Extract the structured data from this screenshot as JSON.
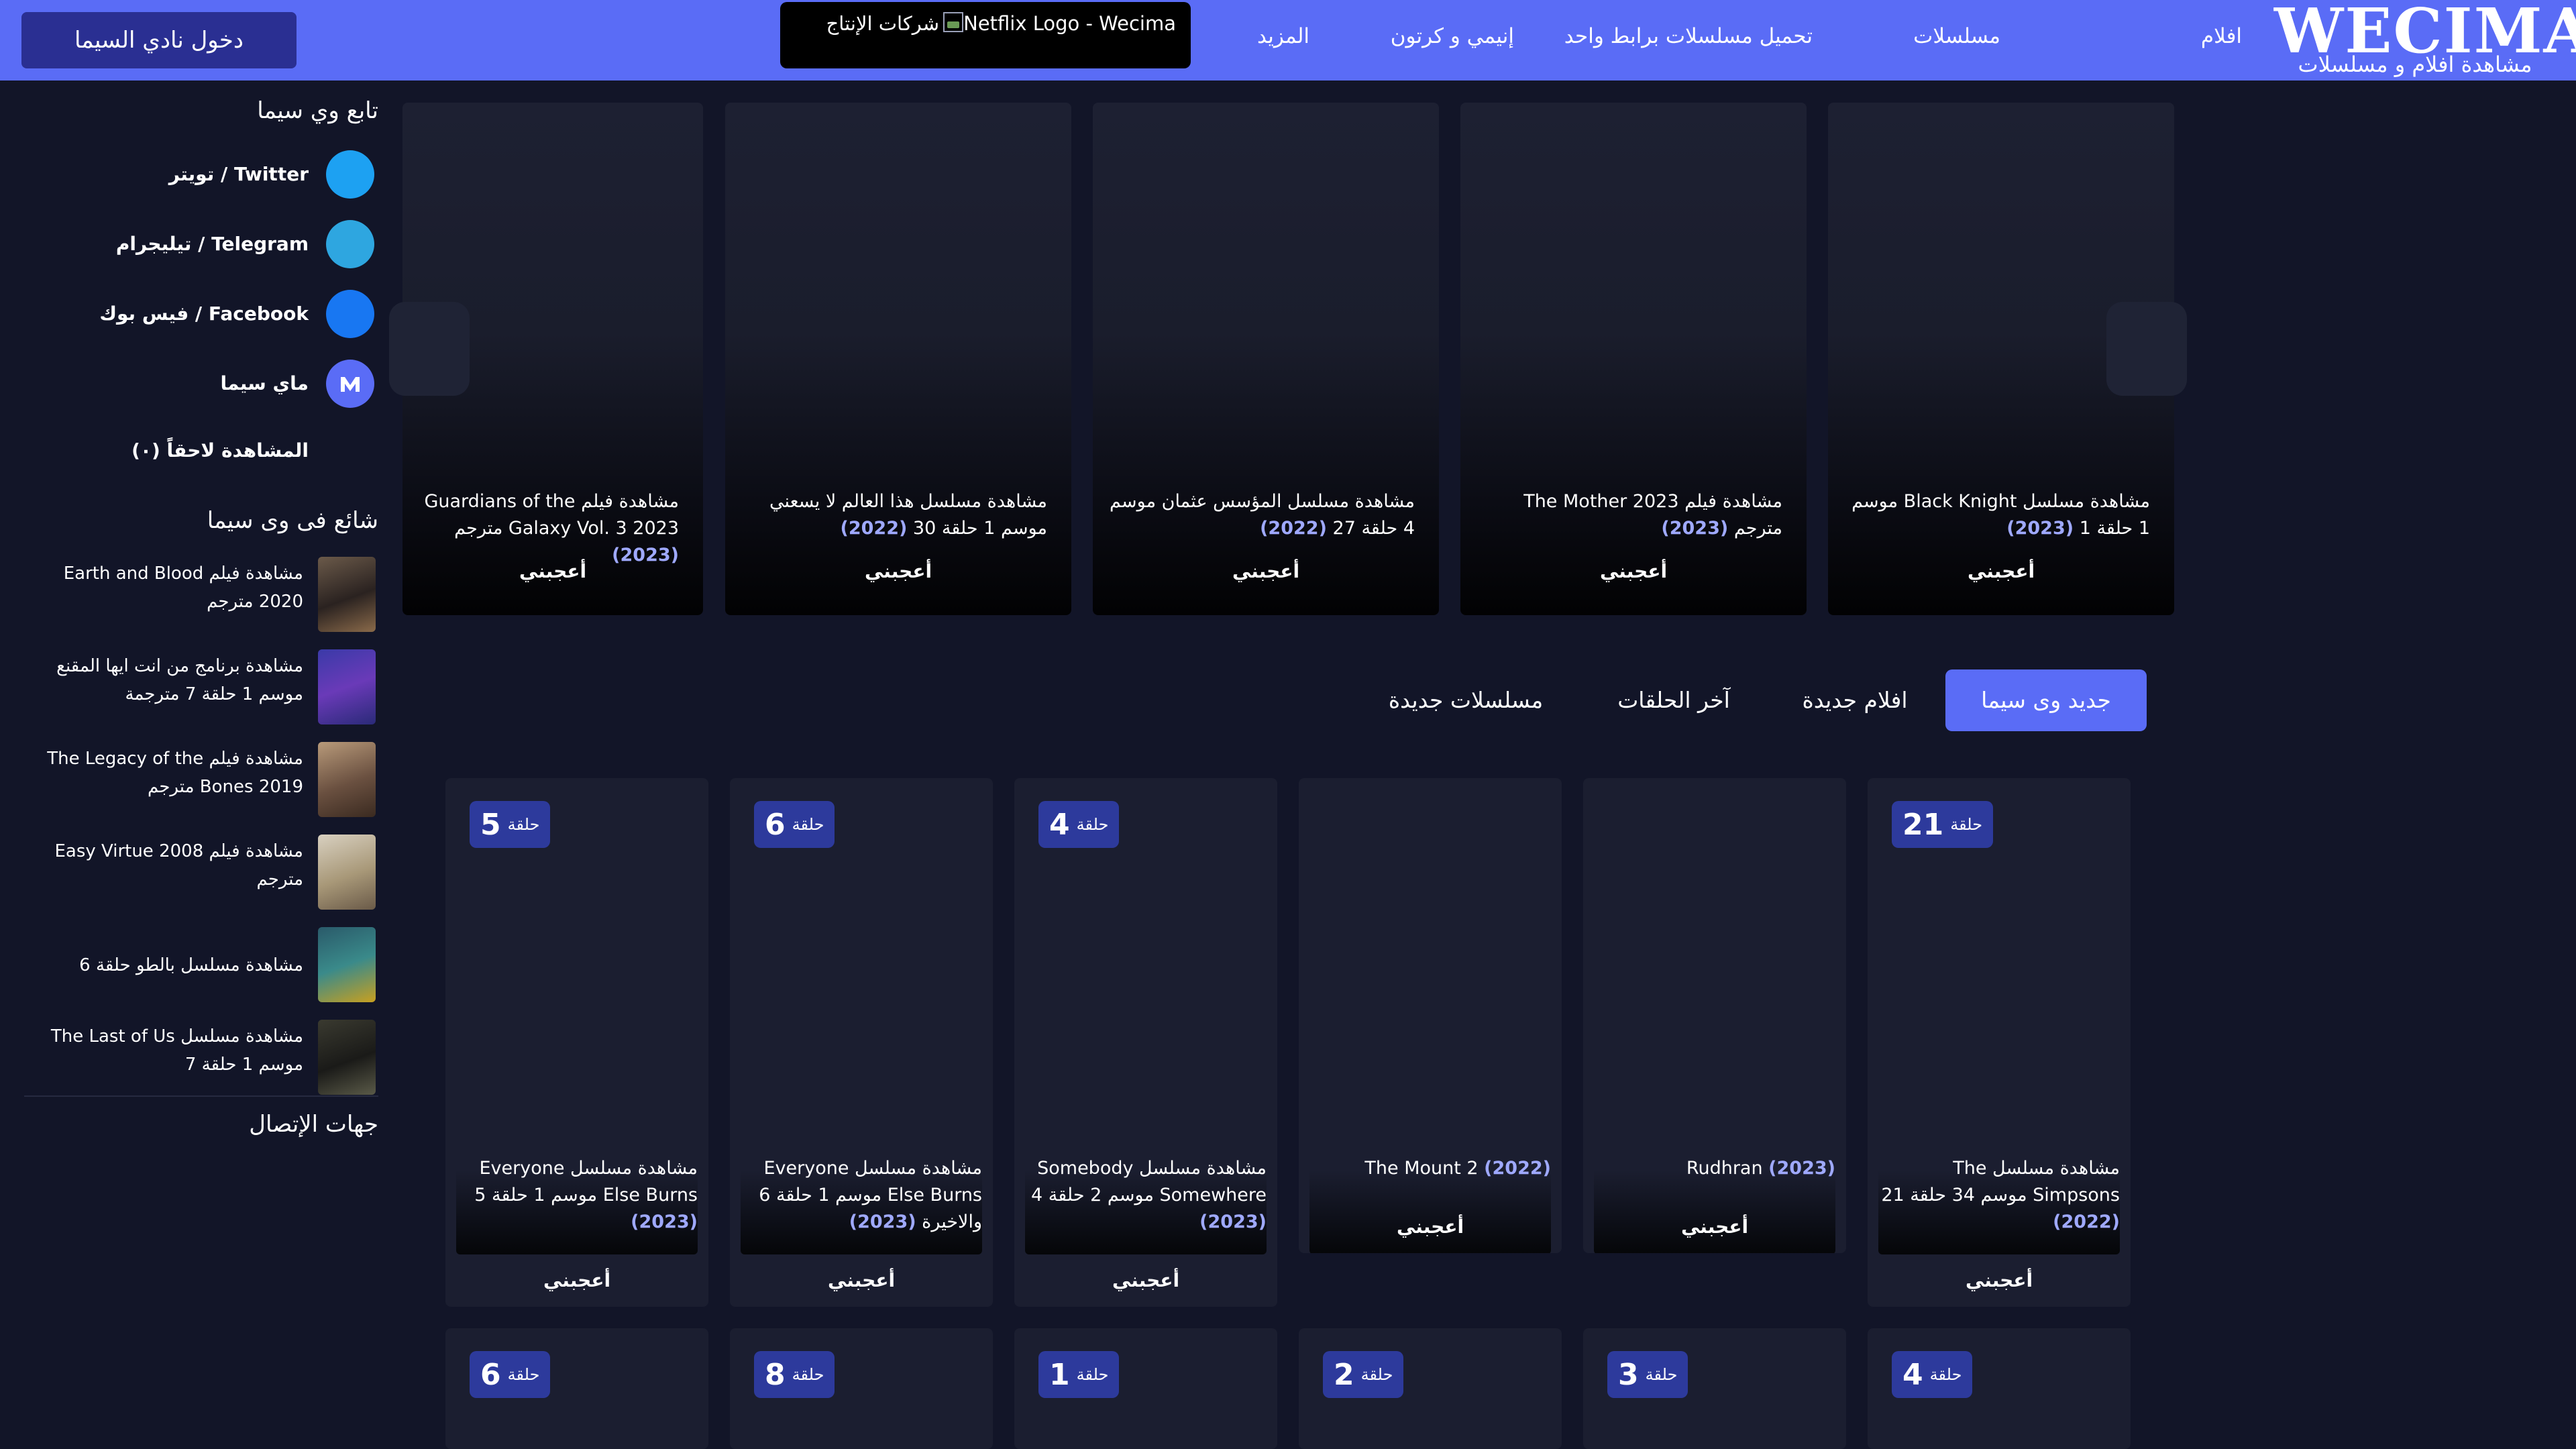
{
  "header": {
    "logo_main": "WECIMA",
    "logo_sub": "مشاهدة افلام و مسلسلات",
    "nav": [
      "افلام",
      "مسلسلات",
      "تحميل مسلسلات برابط واحد",
      "إنيمي و كرتون",
      "المزيد"
    ],
    "netflix_img_alt": "Netflix Logo - Wecima",
    "netflix_label": "شركات الإنتاج",
    "login_button": "دخول نادي السيما"
  },
  "sidebar": {
    "follow_title": "تابع وي سيما",
    "socials": [
      {
        "label": "تويتر / Twitter",
        "color": "#1da1f2",
        "icon": "twitter-icon"
      },
      {
        "label": "تيليجرام / Telegram",
        "color": "#2ea6e0",
        "icon": "telegram-icon"
      },
      {
        "label": "فيس بوك / Facebook",
        "color": "#1877f2",
        "icon": "facebook-icon"
      },
      {
        "label": "ماي سيما",
        "color": "#5a6cf6",
        "icon": "mycima-icon"
      }
    ],
    "watch_later": "المشاهدة لاحقاً (٠)",
    "trending_title": "شائع فى وى سيما",
    "trending": [
      "مشاهدة فيلم Earth and Blood 2020 مترجم",
      "مشاهدة برنامج من انت ايها المقنع موسم 1 حلقة 7 مترجمة",
      "مشاهدة فيلم The Legacy of the Bones 2019 مترجم",
      "مشاهدة فيلم Easy Virtue 2008 مترجم",
      "مشاهدة مسلسل بالطو حلقة 6",
      "مشاهدة مسلسل The Last of Us موسم 1 حلقة 7"
    ],
    "contact_title": "جهات الإتصال"
  },
  "carousel": [
    {
      "title": "مشاهدة مسلسل Black Knight موسم 1 حلقة 1",
      "year": "(2023)",
      "like": "أعجبني"
    },
    {
      "title": "مشاهدة فيلم The Mother 2023 مترجم",
      "year": "(2023)",
      "like": "أعجبني"
    },
    {
      "title": "مشاهدة مسلسل المؤسس عثمان موسم 4 حلقة 27",
      "year": "(2022)",
      "like": "أعجبني"
    },
    {
      "title": "مشاهدة مسلسل هذا العالم لا يسعني موسم 1 حلقة 30",
      "year": "(2022)",
      "like": "أعجبني"
    },
    {
      "title": "مشاهدة فيلم Guardians of the Galaxy Vol. 3 2023 مترجم",
      "year": "(2023)",
      "like": "أعجبني"
    }
  ],
  "tabs": [
    "جديد وى سيما",
    "افلام جديدة",
    "آخر الحلقات",
    "مسلسلات جديدة"
  ],
  "grid": {
    "episode_word": "حلقة",
    "row1": [
      {
        "episode": "21",
        "title": "مشاهدة مسلسل The Simpsons موسم 34 حلقة 21",
        "year": "(2022)",
        "like": "أعجبني"
      },
      {
        "episode": "",
        "title": "Rudhran",
        "year": "(2023)",
        "like": "أعجبني"
      },
      {
        "episode": "",
        "title": "The Mount 2",
        "year": "(2022)",
        "like": "أعجبني"
      },
      {
        "episode": "4",
        "title": "مشاهدة مسلسل Somebody Somewhere موسم 2 حلقة 4",
        "year": "(2023)",
        "like": "أعجبني"
      },
      {
        "episode": "6",
        "title": "مشاهدة مسلسل Everyone Else Burns موسم 1 حلقة 6 والاخيرة",
        "year": "(2023)",
        "like": "أعجبني"
      },
      {
        "episode": "5",
        "title": "مشاهدة مسلسل Everyone Else Burns موسم 1 حلقة 5",
        "year": "(2023)",
        "like": "أعجبني"
      }
    ],
    "row2": [
      {
        "episode": "4"
      },
      {
        "episode": "3"
      },
      {
        "episode": "2"
      },
      {
        "episode": "1"
      },
      {
        "episode": "8"
      },
      {
        "episode": "6"
      }
    ]
  }
}
